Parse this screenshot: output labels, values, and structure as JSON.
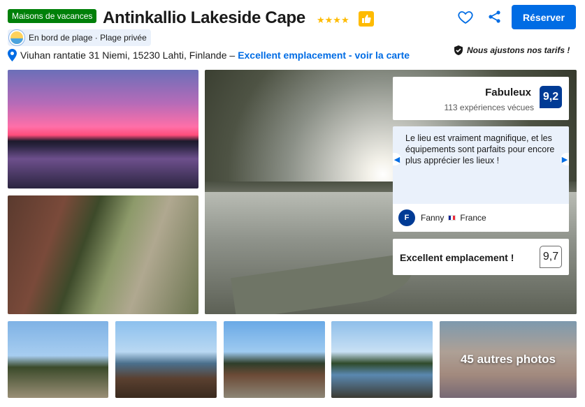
{
  "header": {
    "type_badge": "Maisons de vacances",
    "title": "Antinkallio Lakeside Cape",
    "stars": "★★★★",
    "reserve_label": "Réserver"
  },
  "beach": {
    "label": "En bord de plage · Plage privée"
  },
  "address": {
    "text": "Viuhan rantatie 31 Niemi, 15230 Lahti, Finlande –",
    "link": "Excellent emplacement - voir la carte"
  },
  "price_note": "Nous ajustons nos tarifs !",
  "rating": {
    "word": "Fabuleux",
    "count": "113 expériences vécues",
    "score": "9,2"
  },
  "review": {
    "text": "Le lieu est vraiment magnifique, et les équipements sont parfaits pour encore plus apprécier les lieux !",
    "avatar_initial": "F",
    "author": "Fanny",
    "country": "France"
  },
  "location": {
    "label": "Excellent emplacement !",
    "score": "9,7"
  },
  "gallery": {
    "more_label": "45 autres photos"
  },
  "colors": {
    "brand_blue": "#006ce4",
    "score_blue": "#003b95",
    "badge_green": "#008009",
    "star_yellow": "#febb02"
  }
}
